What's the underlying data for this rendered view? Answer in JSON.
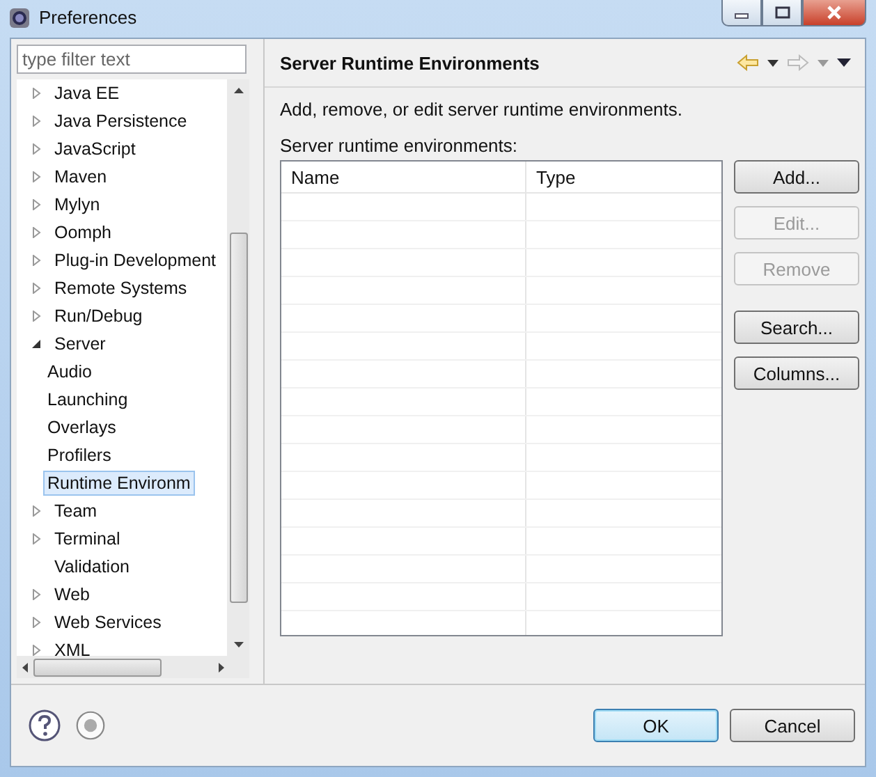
{
  "window": {
    "title": "Preferences"
  },
  "filter": {
    "placeholder": "type filter text"
  },
  "tree": [
    {
      "label": "Java EE",
      "kind": "group",
      "expanded": false,
      "selected": false
    },
    {
      "label": "Java Persistence",
      "kind": "group",
      "expanded": false,
      "selected": false
    },
    {
      "label": "JavaScript",
      "kind": "group",
      "expanded": false,
      "selected": false
    },
    {
      "label": "Maven",
      "kind": "group",
      "expanded": false,
      "selected": false
    },
    {
      "label": "Mylyn",
      "kind": "group",
      "expanded": false,
      "selected": false
    },
    {
      "label": "Oomph",
      "kind": "group",
      "expanded": false,
      "selected": false
    },
    {
      "label": "Plug-in Development",
      "kind": "group",
      "expanded": false,
      "selected": false
    },
    {
      "label": "Remote Systems",
      "kind": "group",
      "expanded": false,
      "selected": false
    },
    {
      "label": "Run/Debug",
      "kind": "group",
      "expanded": false,
      "selected": false
    },
    {
      "label": "Server",
      "kind": "group",
      "expanded": true,
      "selected": false,
      "children": [
        {
          "label": "Audio",
          "selected": false
        },
        {
          "label": "Launching",
          "selected": false
        },
        {
          "label": "Overlays",
          "selected": false
        },
        {
          "label": "Profilers",
          "selected": false
        },
        {
          "label": "Runtime Environm",
          "selected": true
        }
      ]
    },
    {
      "label": "Team",
      "kind": "group",
      "expanded": false,
      "selected": false
    },
    {
      "label": "Terminal",
      "kind": "group",
      "expanded": false,
      "selected": false
    },
    {
      "label": "Validation",
      "kind": "page",
      "selected": false
    },
    {
      "label": "Web",
      "kind": "group",
      "expanded": false,
      "selected": false
    },
    {
      "label": "Web Services",
      "kind": "group",
      "expanded": false,
      "selected": false
    },
    {
      "label": "XML",
      "kind": "group",
      "expanded": false,
      "selected": false
    }
  ],
  "page": {
    "title": "Server Runtime Environments",
    "description": "Add, remove, or edit server runtime environments.",
    "table_label": "Server runtime environments:"
  },
  "table": {
    "columns": [
      "Name",
      "Type"
    ]
  },
  "side_buttons": [
    {
      "label": "Add...",
      "disabled": false
    },
    {
      "label": "Edit...",
      "disabled": true
    },
    {
      "label": "Remove",
      "disabled": true
    },
    {
      "label": "Search...",
      "disabled": false
    },
    {
      "label": "Columns...",
      "disabled": false
    }
  ],
  "dialog_buttons": [
    {
      "label": "OK",
      "default": true
    },
    {
      "label": "Cancel",
      "default": false
    }
  ]
}
